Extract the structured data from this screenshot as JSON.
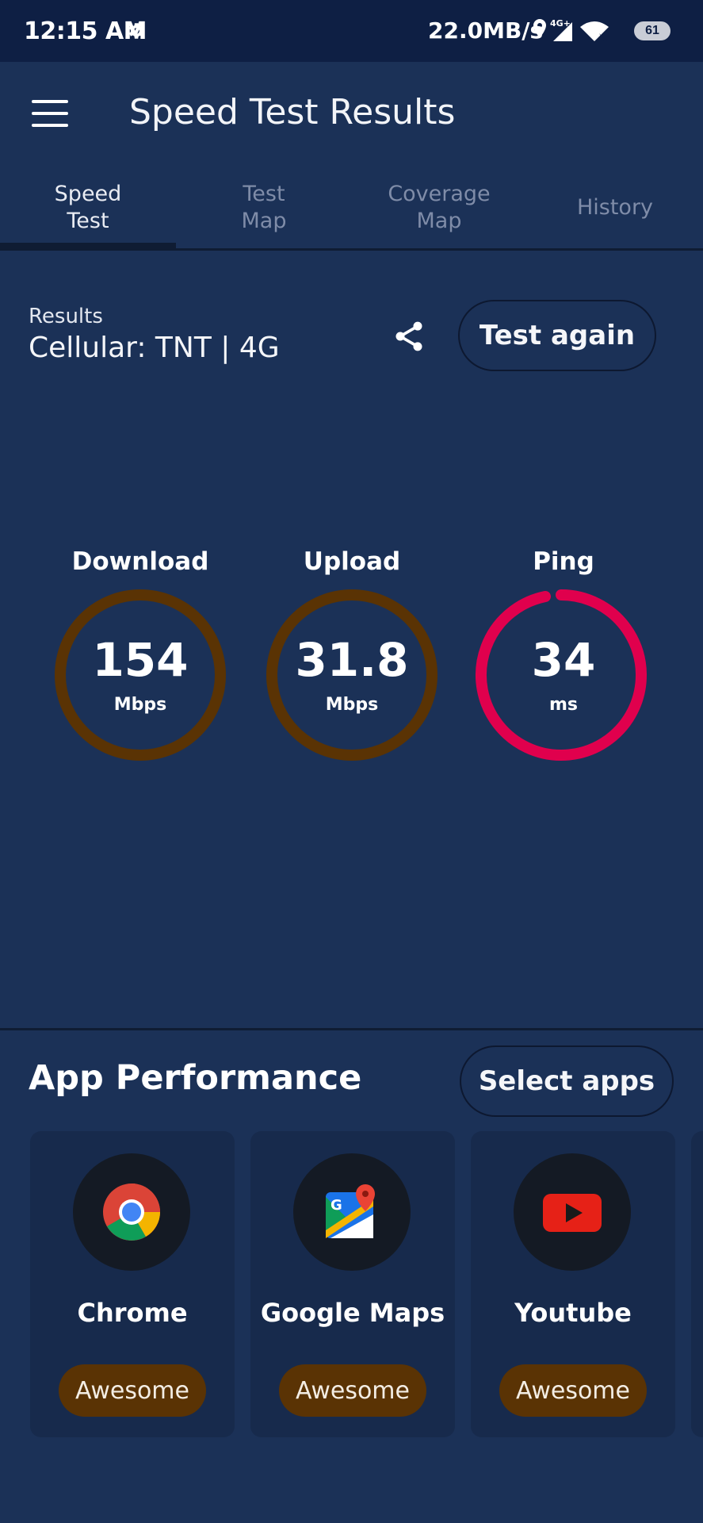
{
  "status_bar": {
    "time": "12:15 AM",
    "net_speed": "22.0MB/s",
    "network_type": "4G+",
    "battery": "61"
  },
  "app_bar": {
    "title": "Speed Test Results"
  },
  "tabs": [
    {
      "label": "Speed\nTest",
      "active": true
    },
    {
      "label": "Test\nMap",
      "active": false
    },
    {
      "label": "Coverage\nMap",
      "active": false
    },
    {
      "label": "History",
      "active": false
    }
  ],
  "results": {
    "label": "Results",
    "connection": "Cellular: TNT | 4G",
    "test_again_label": "Test again"
  },
  "gauges": [
    {
      "label": "Download",
      "value": "154",
      "unit": "Mbps",
      "color": "#5a3304"
    },
    {
      "label": "Upload",
      "value": "31.8",
      "unit": "Mbps",
      "color": "#5a3304"
    },
    {
      "label": "Ping",
      "value": "34",
      "unit": "ms",
      "color": "#e0004d"
    }
  ],
  "app_performance": {
    "title": "App Performance",
    "select_apps_label": "Select apps",
    "apps": [
      {
        "name": "Chrome",
        "icon": "chrome-icon",
        "rating": "Awesome"
      },
      {
        "name": "Google Maps",
        "icon": "google-maps-icon",
        "rating": "Awesome"
      },
      {
        "name": "Youtube",
        "icon": "youtube-icon",
        "rating": "Awesome"
      }
    ]
  },
  "colors": {
    "background": "#1b3157",
    "status_bar": "#0e1f44",
    "card": "#172a4c",
    "rating_badge": "#5a3304",
    "ping_ring": "#e0004d"
  }
}
